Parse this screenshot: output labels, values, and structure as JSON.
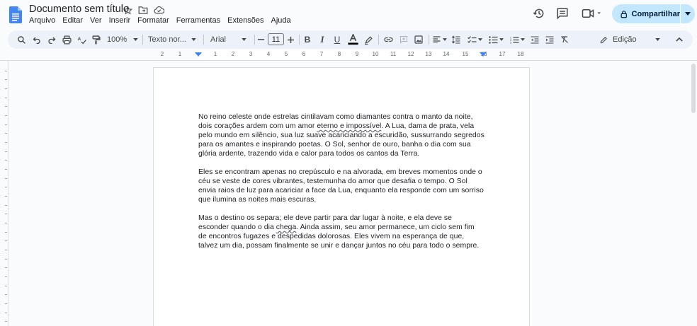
{
  "header": {
    "title": "Documento sem título",
    "menu": [
      "Arquivo",
      "Editar",
      "Ver",
      "Inserir",
      "Formatar",
      "Ferramentas",
      "Extensões",
      "Ajuda"
    ],
    "share_label": "Compartilhar"
  },
  "toolbar": {
    "zoom": "100%",
    "style": "Texto nor...",
    "font": "Arial",
    "font_size": "11",
    "mode": "Edição",
    "text_color": "#000000",
    "accent": "#c2e7ff"
  },
  "ruler": {
    "numbers": [
      "2",
      "1",
      "1",
      "2",
      "3",
      "4",
      "5",
      "6",
      "7",
      "8",
      "9",
      "10",
      "11",
      "12",
      "13",
      "14",
      "15",
      "16",
      "17",
      "18"
    ]
  },
  "document": {
    "p1a": "No reino celeste onde estrelas cintilavam como diamantes contra o manto da noite, dois corações ardem com um amor ",
    "p1b": "eterno e impossível",
    "p1c": ". A Lua, dama de prata, vela pelo mundo em silêncio, sua luz suave acariciando a escuridão, sussurrando segredos para os amantes e inspirando poetas. O Sol, senhor de ouro, banha o dia com sua glória ardente, trazendo vida e calor para todos os cantos da Terra.",
    "p2": "Eles se encontram apenas no crepúsculo e na alvorada, em breves momentos onde o céu se veste de cores vibrantes, testemunha do amor que desafia o tempo. O Sol envia raios de luz para acariciar a face da Lua, enquanto ela responde com um sorriso que ilumina as noites mais escuras.",
    "p3a": "Mas o destino os separa; ele deve partir para dar lugar à noite, e ela deve se esconder quando o dia ",
    "p3b": "chega",
    "p3c": ". Ainda assim, seu amor permanece, um ciclo sem fim de encontros fugazes e despedidas dolorosas. Eles vivem na esperança de que, talvez um dia, possam finalmente se unir e dançar juntos no céu para todo o sempre."
  }
}
